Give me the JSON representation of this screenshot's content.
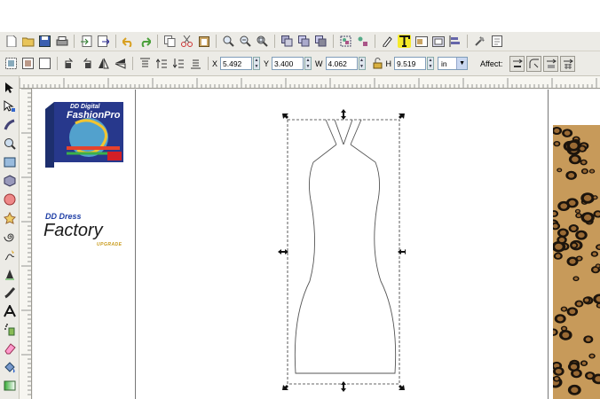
{
  "commands": {
    "icons": [
      "new-icon",
      "open-icon",
      "save-icon",
      "print-icon",
      "import-icon",
      "export-icon",
      "undo-icon",
      "redo-icon",
      "copy-icon",
      "cut-icon",
      "paste-icon",
      "zoom-selection-icon",
      "zoom-drawing-icon",
      "zoom-page-icon",
      "duplicate-icon",
      "clone-icon",
      "unlink-clone-icon",
      "group-icon",
      "ungroup-icon",
      "fill-stroke-icon",
      "text-font-icon",
      "layers-icon",
      "xml-editor-icon",
      "align-icon",
      "preferences-icon",
      "document-properties-icon"
    ]
  },
  "controls": {
    "x_label": "X",
    "x_value": "5.492",
    "y_label": "Y",
    "y_value": "3.400",
    "w_label": "W",
    "w_value": "4.062",
    "h_label": "H",
    "h_value": "9.519",
    "unit": "in",
    "affect_label": "Affect:"
  },
  "tools": [
    "selector-tool",
    "node-tool",
    "tweak-tool",
    "zoom-tool",
    "rectangle-tool",
    "3d-box-tool",
    "ellipse-tool",
    "star-tool",
    "spiral-tool",
    "pencil-tool",
    "pen-tool",
    "calligraphy-tool",
    "text-tool",
    "spray-tool",
    "eraser-tool",
    "paint-bucket-tool",
    "gradient-tool"
  ],
  "brand": {
    "box_company": "DD Digital",
    "box_title": "FashionPro",
    "dress_prefix": "DD Dress",
    "factory": "Factory",
    "upgrade": "UPGRADE"
  },
  "colors": {
    "highlight": "#f5ea2a",
    "chrome": "#ecebe6",
    "brand_blue": "#1f3fa6",
    "upgrade_gold": "#c89a1a"
  }
}
